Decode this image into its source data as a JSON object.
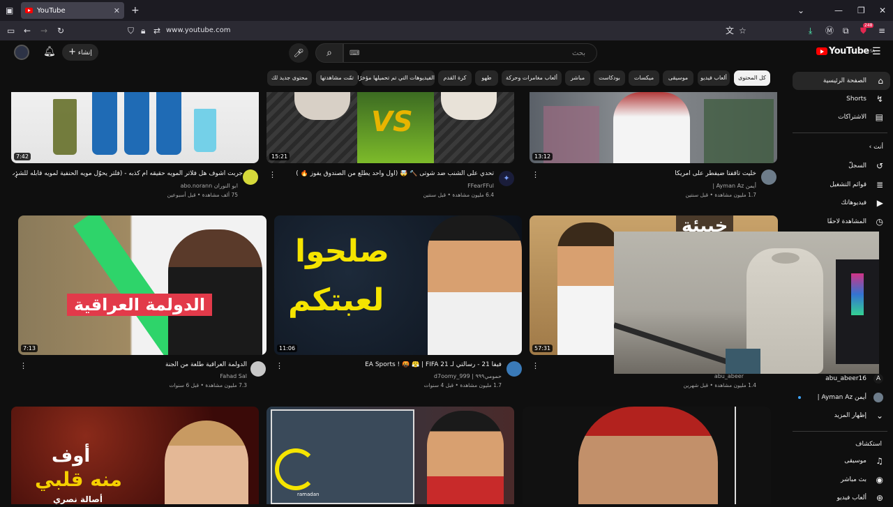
{
  "browser": {
    "tab_title": "YouTube",
    "url": "www.youtube.com",
    "ext_badge": "248"
  },
  "header": {
    "logo_text": "YouTube",
    "region": "SA",
    "search_placeholder": "بحث",
    "create_label": "إنشاء"
  },
  "chips": [
    "كل المحتوى",
    "ألعاب فيديو",
    "موسيقى",
    "ميكسات",
    "بودكاست",
    "مباشر",
    "ألعاب مغامرات وحركة",
    "طهو",
    "كرة القدم",
    "الفيديوهات التي تم تحميلها مؤخرًا",
    "تمّت مشاهدتها",
    "محتوى جديد لك"
  ],
  "sidebar": {
    "home": "الصفحة الرئيسية",
    "shorts": "Shorts",
    "subscriptions": "الاشتراكات",
    "you": "أنت",
    "history": "السجلّ",
    "playlists": "قوائم التشغيل",
    "your_videos": "فيديوهاتك",
    "watch_later": "المشاهدة لاحقًا",
    "sub1": "abu_abeer16",
    "sub2": "أيمن Ayman Az |",
    "show_more": "إظهار المزيد",
    "explore": "استكشاف",
    "music": "موسيقى",
    "live": "بث مباشر",
    "gaming": "ألعاب فيديو"
  },
  "videos": {
    "r1": [
      {
        "title": "جربت اشوف هل فلاتر المويه حقيقه ام كذبه - (فلتر يحوّل مويه الحنفية لمويه قابله للشرب)",
        "channel": "ابو النوران abo.norann",
        "meta": "75 ألف مشاهدة • قبل أسبوعين",
        "duration": "7:42"
      },
      {
        "title": "تحدي على الشنب ضد شوتى 🔨 🤯 (اول واحد يطلع من الصندوق يفوز 🔥 )",
        "channel": "FFearFFul",
        "meta": "6.4 مليون مشاهدة • قبل سنتين",
        "duration": "15:21"
      },
      {
        "title": "خليت تاقفتا ضيفطر على امريكا",
        "channel": "أيمن Ayman Az |",
        "meta": "1.7 مليون مشاهدة • قبل سنتين",
        "duration": "13:12"
      }
    ],
    "r2": [
      {
        "title": "الدولمة العراقية طلعة من الجنة",
        "channel": "Fahad Sal",
        "meta": "7.3 مليون مشاهدة • قبل 6 سنوات",
        "duration": "7:13",
        "overlay": "الدولمة العراقية"
      },
      {
        "title": "فيفا 21 - رسالتي لـ EA Sports ! 🤬 😤 | FIFA 21",
        "channel": "حمومي٩٩٩ | d7oomy_999",
        "meta": "1.7 مليون مشاهدة • قبل 4 سنوات",
        "duration": "11:06",
        "overlay1": "صلحوا",
        "overlay2": "لعبتكم"
      },
      {
        "title": "",
        "channel": "abu_abeer",
        "meta": "1.4 مليون مشاهدة • قبل شهرين",
        "duration": "57:31",
        "overlay": "خبيئة"
      }
    ],
    "r3": [
      {
        "overlay1": "أوف",
        "overlay2": "منه قلبي",
        "overlay3": "أصالة نصري"
      },
      {
        "overlay": "ramadan"
      },
      {}
    ]
  },
  "colors": {
    "accent": "#ff0000",
    "bg": "#0f0f0f",
    "chip": "#272727"
  }
}
